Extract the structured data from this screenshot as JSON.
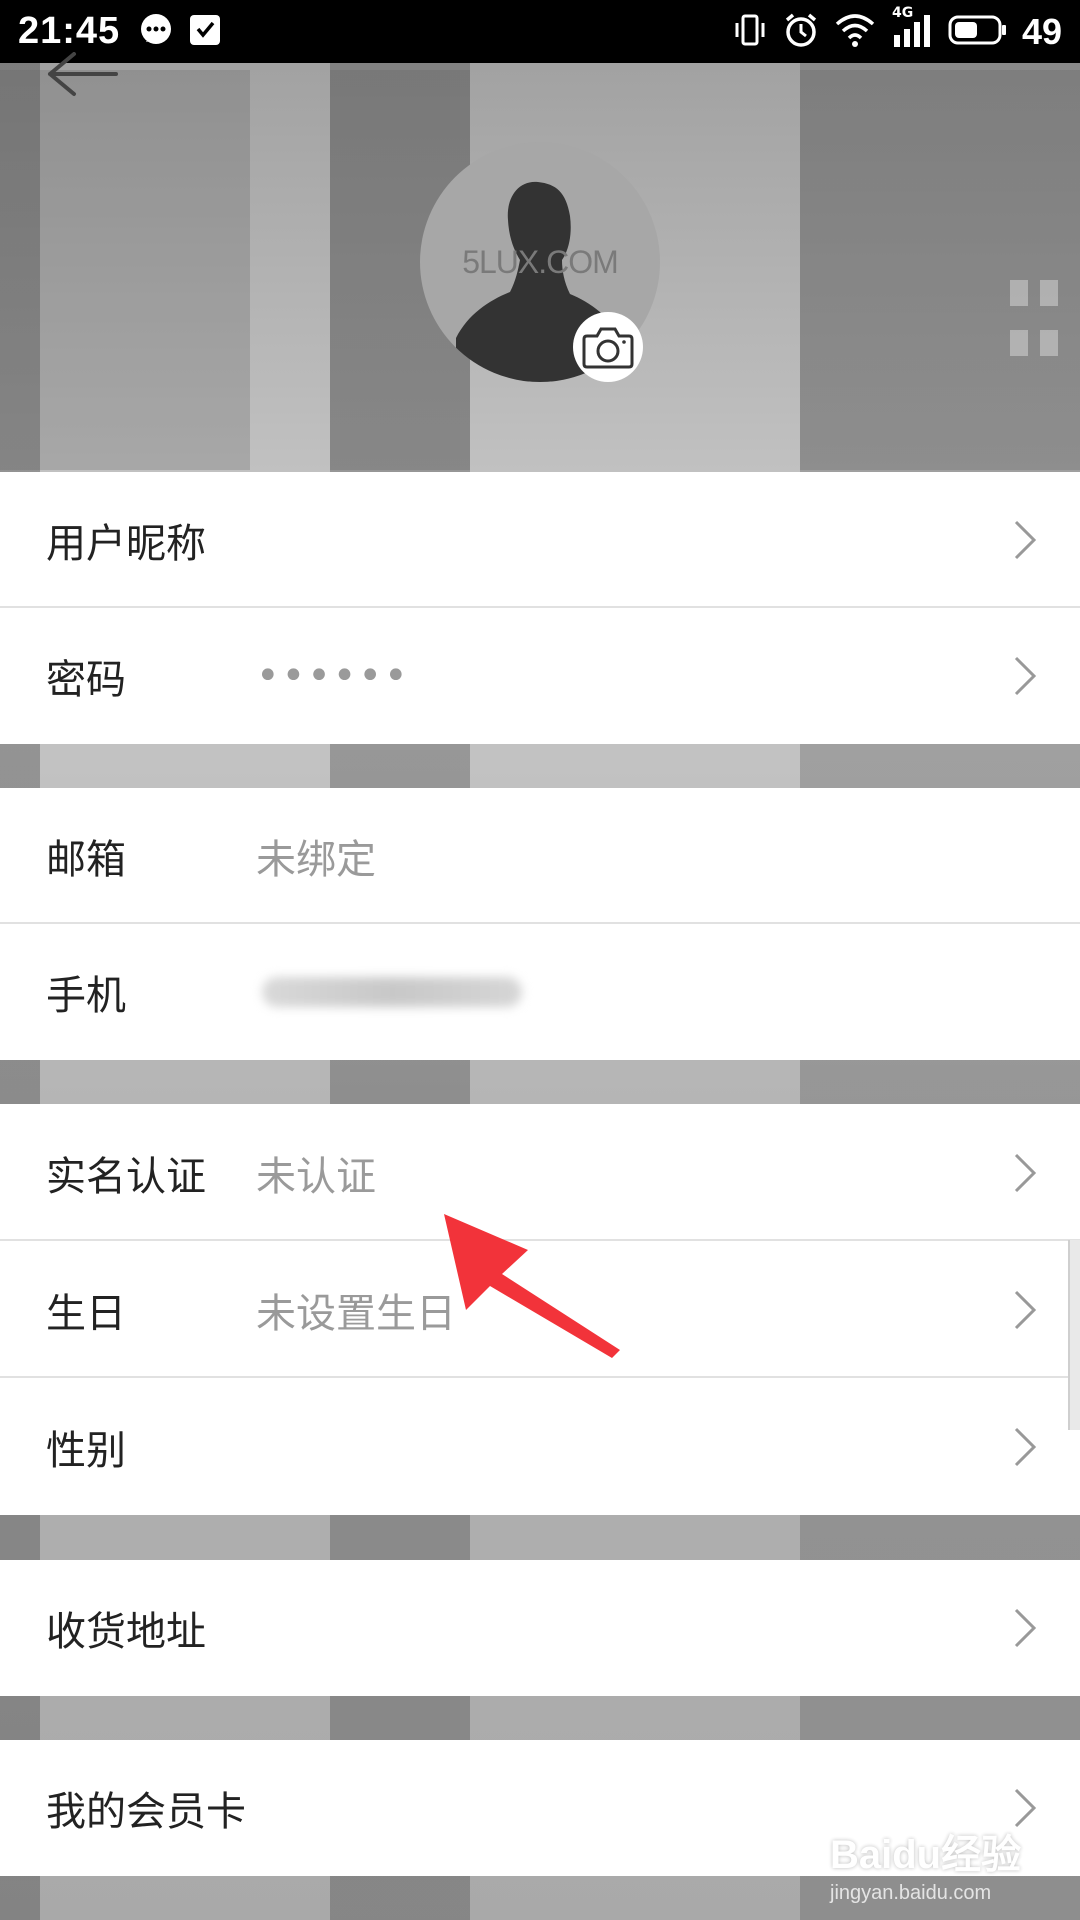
{
  "status_bar": {
    "time": "21:45",
    "battery": "49",
    "network": "4G"
  },
  "header": {
    "avatar_watermark": "5LUX.COM"
  },
  "rows": [
    {
      "label": "用户昵称",
      "value": ""
    },
    {
      "label": "密码",
      "value": "••••••"
    },
    {
      "label": "邮箱",
      "value": "未绑定"
    },
    {
      "label": "手机",
      "value": ""
    },
    {
      "label": "实名认证",
      "value": "未认证"
    },
    {
      "label": "生日",
      "value": "未设置生日"
    },
    {
      "label": "性别",
      "value": ""
    },
    {
      "label": "收货地址",
      "value": ""
    },
    {
      "label": "我的会员卡",
      "value": ""
    }
  ],
  "watermark": {
    "brand": "Baidu经验",
    "url": "jingyan.baidu.com"
  },
  "colors": {
    "annotation_arrow": "#f2333a",
    "row_background": "#ffffff",
    "label_text": "#222222",
    "value_text": "#9a9a9a"
  }
}
